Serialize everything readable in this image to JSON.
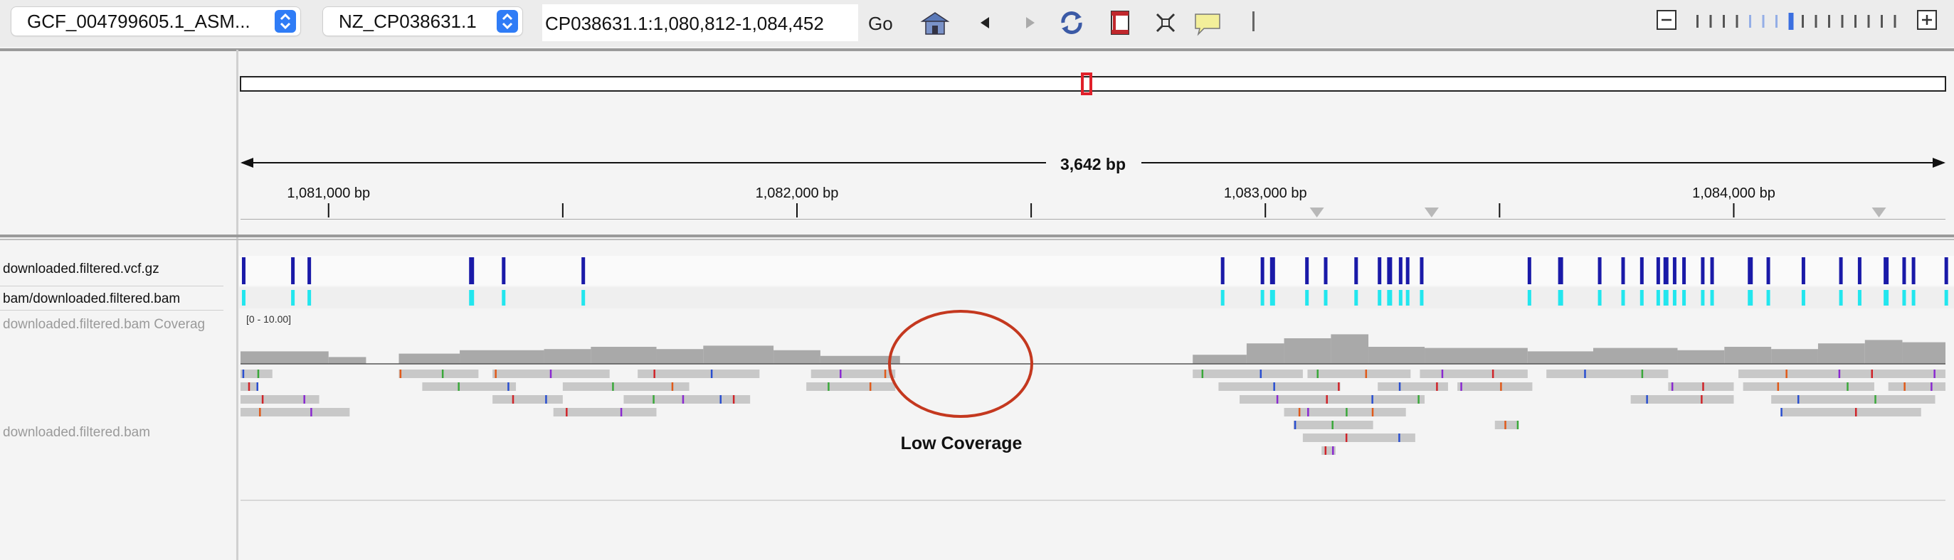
{
  "toolbar": {
    "genome": "GCF_004799605.1_ASM...",
    "chromosome": "NZ_CP038631.1",
    "locus": "CP038631.1:1,080,812-1,084,452",
    "go_label": "Go",
    "icons": [
      "home-icon",
      "back-arrow-icon",
      "forward-arrow-icon",
      "refresh-icon",
      "region-of-interest-icon",
      "fit-to-window-icon",
      "popup-info-icon"
    ],
    "zoom": {
      "level_fraction": 0.45
    }
  },
  "ruler": {
    "span_label": "3,642 bp",
    "ticks": [
      {
        "label": "1,081,000 bp",
        "pos": 1081000
      },
      {
        "label": "1,082,000 bp",
        "pos": 1082000
      },
      {
        "label": "1,083,000 bp",
        "pos": 1083000
      },
      {
        "label": "1,084,000 bp",
        "pos": 1084000
      }
    ],
    "view_start": 1080812,
    "view_end": 1084452,
    "minor_ticks": [
      1081500,
      1082500,
      1083500
    ],
    "markers": [
      1083110,
      1083355,
      1084310
    ]
  },
  "tracks": {
    "vcf": "downloaded.filtered.vcf.gz",
    "bam_variants": "bam/downloaded.filtered.bam",
    "coverage": "downloaded.filtered.bam Coverag",
    "coverage_range": "[0 - 10.00]",
    "alignments": "downloaded.filtered.bam"
  },
  "variants": [
    1080815,
    1080920,
    1080955,
    1081300,
    1081370,
    1081540,
    1082905,
    1082990,
    1083010,
    1083085,
    1083125,
    1083190,
    1083240,
    1083260,
    1083285,
    1083300,
    1083330,
    1083560,
    1083625,
    1083710,
    1083760,
    1083800,
    1083835,
    1083850,
    1083870,
    1083890,
    1083930,
    1083950,
    1084030,
    1084070,
    1084145,
    1084225,
    1084265,
    1084320,
    1084360,
    1084380,
    1084450
  ],
  "annotation": {
    "text": "Low Coverage"
  },
  "colors": {
    "variant_dark": "#1a1aa8",
    "variant_cyan": "#22e6ee",
    "coverage": "#a9a9a9",
    "read": "#c8c8c8",
    "circle": "#c0392b",
    "zoom_active": "#3b6fe0"
  }
}
